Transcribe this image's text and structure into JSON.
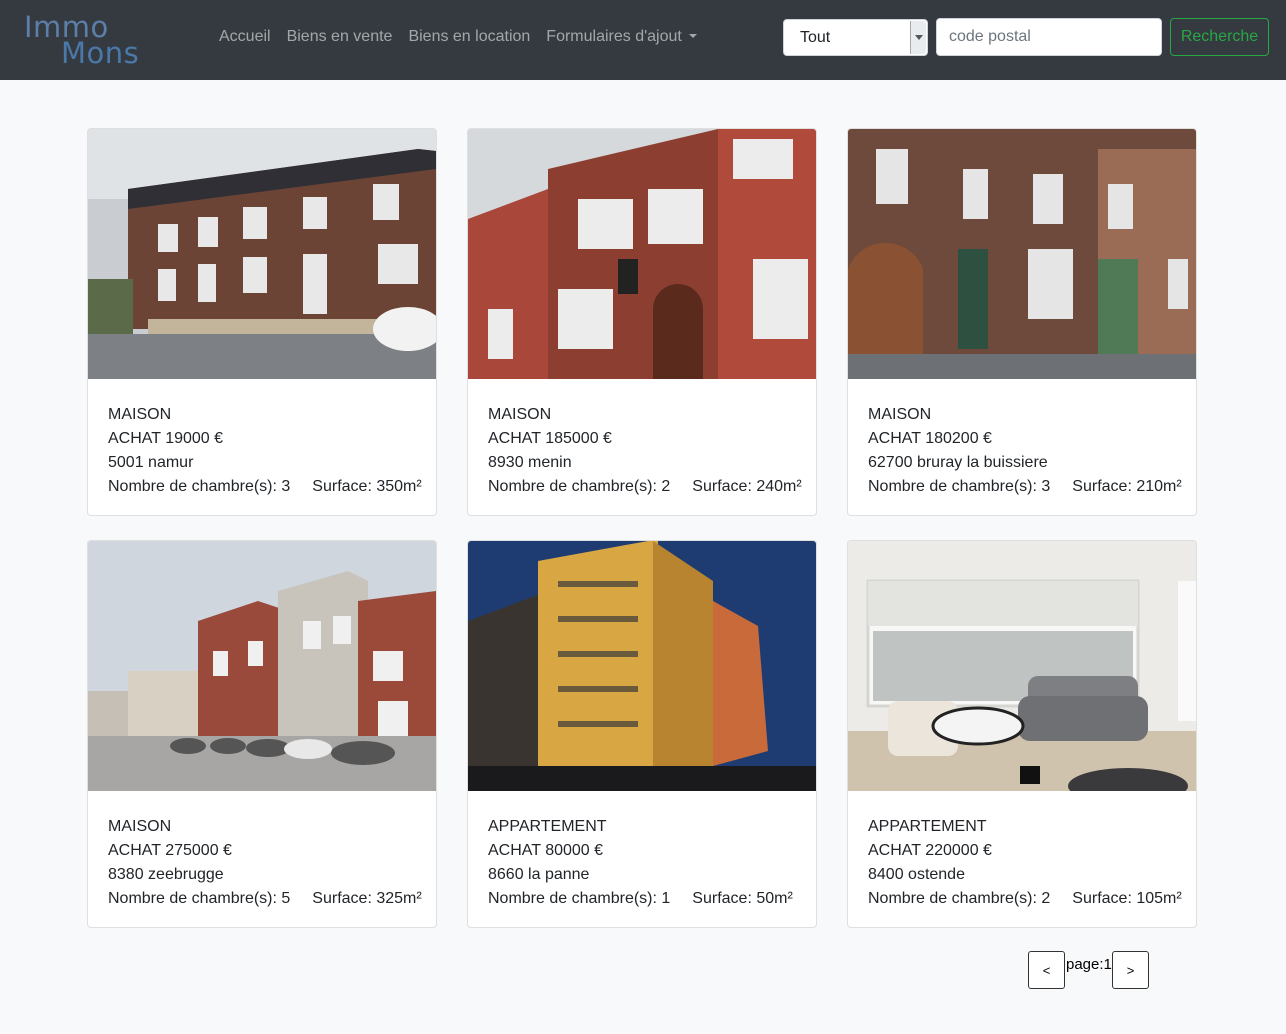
{
  "brand": {
    "line1": "Immo",
    "line2": "Mons"
  },
  "nav": {
    "links": [
      "Accueil",
      "Biens en vente",
      "Biens en location",
      "Formulaires d'ajout"
    ]
  },
  "search": {
    "type_selected": "Tout",
    "postal_placeholder": "code postal",
    "button_label": "Recherche"
  },
  "listings": [
    {
      "type": "MAISON",
      "price": "ACHAT 19000 €",
      "location": "5001 namur",
      "rooms": "Nombre de chambre(s): 3",
      "surface": "Surface: 350m²"
    },
    {
      "type": "MAISON",
      "price": "ACHAT 185000 €",
      "location": "8930 menin",
      "rooms": "Nombre de chambre(s): 2",
      "surface": "Surface: 240m²"
    },
    {
      "type": "MAISON",
      "price": "ACHAT 180200 €",
      "location": "62700 bruray la buissiere",
      "rooms": "Nombre de chambre(s): 3",
      "surface": "Surface: 210m²"
    },
    {
      "type": "MAISON",
      "price": "ACHAT 275000 €",
      "location": "8380 zeebrugge",
      "rooms": "Nombre de chambre(s): 5",
      "surface": "Surface: 325m²"
    },
    {
      "type": "APPARTEMENT",
      "price": "ACHAT 80000 €",
      "location": "8660 la panne",
      "rooms": "Nombre de chambre(s): 1",
      "surface": "Surface: 50m²"
    },
    {
      "type": "APPARTEMENT",
      "price": "ACHAT 220000 €",
      "location": "8400 ostende",
      "rooms": "Nombre de chambre(s): 2",
      "surface": "Surface: 105m²"
    }
  ],
  "pagination": {
    "prev_label": "<",
    "page_label": "page:1",
    "next_label": ">"
  }
}
